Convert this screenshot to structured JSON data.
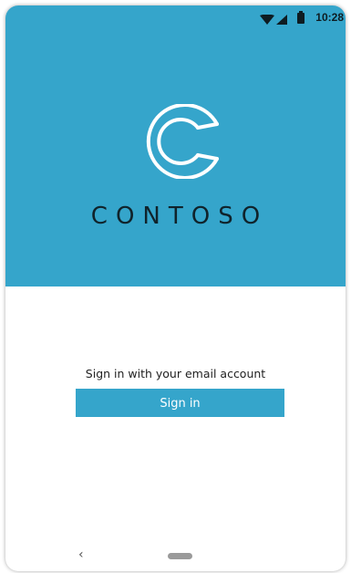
{
  "status_bar": {
    "time": "10:28",
    "icons": [
      "wifi-icon",
      "signal-icon",
      "battery-icon"
    ]
  },
  "brand": {
    "logo_icon": "contoso-logo-icon",
    "name": "CONTOSO"
  },
  "signin": {
    "prompt": "Sign in with your email account",
    "button_label": "Sign in"
  },
  "navigation": {
    "back_glyph": "‹",
    "icons": [
      "back-icon",
      "home-pill-icon"
    ]
  },
  "colors": {
    "accent": "#35a5cb",
    "brand_text": "#10232b",
    "button_text": "#ffffff"
  }
}
